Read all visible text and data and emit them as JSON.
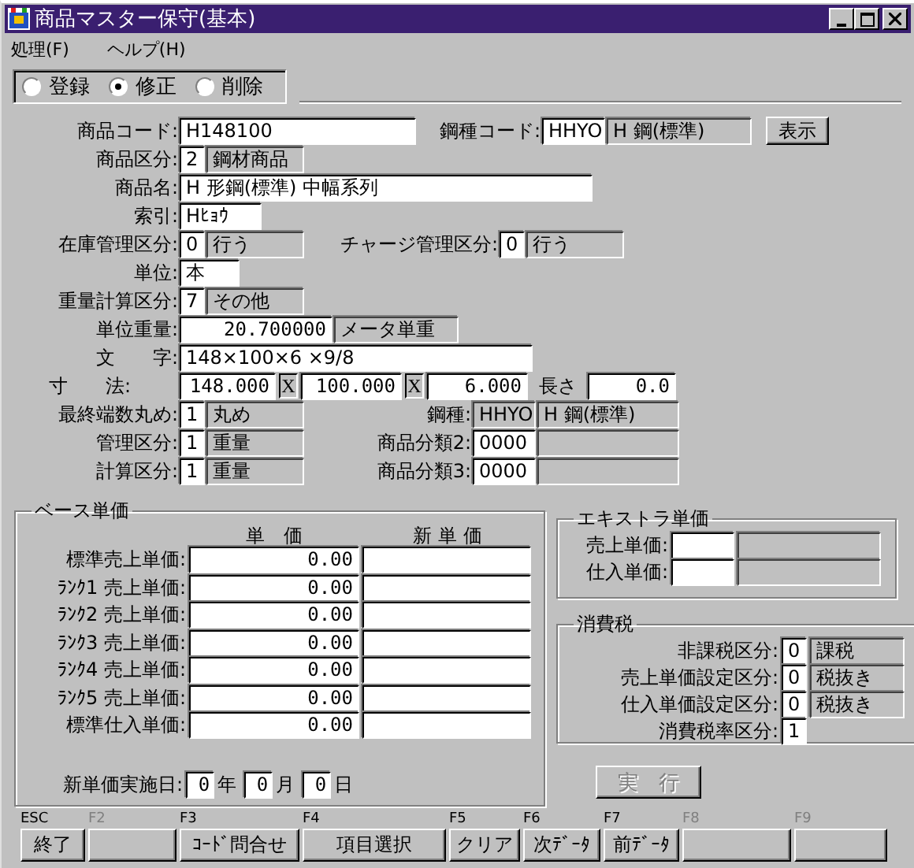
{
  "window": {
    "title": "商品マスター保守(基本)"
  },
  "menu": [
    "処理(F)",
    "ヘルプ(H)"
  ],
  "mode": [
    {
      "label": "登録",
      "selected": false
    },
    {
      "label": "修正",
      "selected": true
    },
    {
      "label": "削除",
      "selected": false
    }
  ],
  "form_rows": [
    [
      {
        "kind": "label",
        "text": "商品コード:"
      },
      {
        "kind": "input",
        "text": "H148100"
      },
      {
        "kind": "label",
        "text": "鋼種コード:"
      },
      {
        "kind": "input",
        "text": "HHYO"
      },
      {
        "kind": "display",
        "text": "H 鋼(標準)"
      },
      {
        "kind": "button",
        "text": "表示"
      }
    ],
    [
      {
        "kind": "label",
        "text": "商品区分:"
      },
      {
        "kind": "input",
        "text": "2"
      },
      {
        "kind": "display",
        "text": "鋼材商品"
      }
    ],
    [
      {
        "kind": "label",
        "text": "商品名:"
      },
      {
        "kind": "input",
        "text": "H 形鋼(標準) 中幅系列"
      }
    ],
    [
      {
        "kind": "label",
        "text": "索引:"
      },
      {
        "kind": "input",
        "text": "Hﾋｮｳ"
      }
    ],
    [
      {
        "kind": "label",
        "text": "在庫管理区分:"
      },
      {
        "kind": "input",
        "text": "0"
      },
      {
        "kind": "display",
        "text": "行う"
      },
      {
        "kind": "label",
        "text": "チャージ管理区分:"
      },
      {
        "kind": "input",
        "text": "0"
      },
      {
        "kind": "display",
        "text": "行う"
      }
    ],
    [
      {
        "kind": "label",
        "text": "単位:"
      },
      {
        "kind": "input",
        "text": "本"
      }
    ],
    [
      {
        "kind": "label",
        "text": "重量計算区分:"
      },
      {
        "kind": "input",
        "text": "7"
      },
      {
        "kind": "display",
        "text": "その他"
      }
    ],
    [
      {
        "kind": "label",
        "text": "単位重量:"
      },
      {
        "kind": "number",
        "text": "20.700000"
      },
      {
        "kind": "display",
        "text": "メータ単重"
      }
    ],
    [
      {
        "kind": "label",
        "text": "文　　字:"
      },
      {
        "kind": "input",
        "text": "148×100×6 ×9/8"
      }
    ],
    [
      {
        "kind": "label",
        "text": "寸　　法:"
      },
      {
        "kind": "number",
        "text": "148.000"
      },
      {
        "kind": "sep",
        "text": "X"
      },
      {
        "kind": "number",
        "text": "100.000"
      },
      {
        "kind": "sep",
        "text": "X"
      },
      {
        "kind": "number",
        "text": "6.000"
      },
      {
        "kind": "label",
        "text": "長さ"
      },
      {
        "kind": "number",
        "text": "0.0"
      }
    ],
    [
      {
        "kind": "label",
        "text": "最終端数丸め:"
      },
      {
        "kind": "input",
        "text": "1"
      },
      {
        "kind": "display",
        "text": "丸め"
      },
      {
        "kind": "label",
        "text": "鋼種:"
      },
      {
        "kind": "display",
        "text": "HHYO"
      },
      {
        "kind": "display",
        "text": "H 鋼(標準)"
      }
    ],
    [
      {
        "kind": "label",
        "text": "管理区分:"
      },
      {
        "kind": "input",
        "text": "1"
      },
      {
        "kind": "display",
        "text": "重量"
      },
      {
        "kind": "label",
        "text": "商品分類2:"
      },
      {
        "kind": "input",
        "text": "0000"
      },
      {
        "kind": "display"
      }
    ],
    [
      {
        "kind": "label",
        "text": "計算区分:"
      },
      {
        "kind": "input",
        "text": "1"
      },
      {
        "kind": "display",
        "text": "重量"
      },
      {
        "kind": "label",
        "text": "商品分類3:"
      },
      {
        "kind": "input",
        "text": "0000"
      },
      {
        "kind": "display"
      }
    ]
  ],
  "base_price": {
    "title": "ベース単価",
    "columns": [
      "単　価",
      "新 単 価"
    ],
    "rows": [
      {
        "label": "標準売上単価:",
        "price": "0.00"
      },
      {
        "label": "ﾗﾝｸ1 売上単価:",
        "price": "0.00"
      },
      {
        "label": "ﾗﾝｸ2 売上単価:",
        "price": "0.00"
      },
      {
        "label": "ﾗﾝｸ3 売上単価:",
        "price": "0.00"
      },
      {
        "label": "ﾗﾝｸ4 売上単価:",
        "price": "0.00"
      },
      {
        "label": "ﾗﾝｸ5 売上単価:",
        "price": "0.00"
      },
      {
        "label": "標準仕入単価:",
        "price": "0.00"
      }
    ],
    "date": {
      "label": "新単価実施日:",
      "parts": [
        {
          "value": "0",
          "unit": "年"
        },
        {
          "value": "0",
          "unit": "月"
        },
        {
          "value": "0",
          "unit": "日"
        }
      ]
    }
  },
  "extra_price": {
    "title": "エキストラ単価",
    "rows": [
      {
        "label": "売上単価:"
      },
      {
        "label": "仕入単価:"
      }
    ]
  },
  "tax": {
    "title": "消費税",
    "rows": [
      {
        "label": "非課税区分:",
        "value": "0",
        "name": "課税"
      },
      {
        "label": "売上単価設定区分:",
        "value": "0",
        "name": "税抜き"
      },
      {
        "label": "仕入単価設定区分:",
        "value": "0",
        "name": "税抜き"
      },
      {
        "label": "消費税率区分:",
        "value": "1"
      }
    ]
  },
  "execute_button": {
    "label": "実　行",
    "disabled": true
  },
  "function_keys": [
    {
      "key": "ESC",
      "label": "終了",
      "disabled": false
    },
    {
      "key": "F2",
      "disabled": true
    },
    {
      "key": "F3",
      "label": "ｺｰﾄﾞ問合せ",
      "disabled": false
    },
    {
      "key": "F4",
      "label": "項目選択",
      "disabled": false
    },
    {
      "key": "F5",
      "label": "クリア",
      "disabled": false
    },
    {
      "key": "F6",
      "label": "次ﾃﾞｰﾀ",
      "disabled": false
    },
    {
      "key": "F7",
      "label": "前ﾃﾞｰﾀ",
      "disabled": false
    },
    {
      "key": "F8",
      "disabled": true
    },
    {
      "key": "F9",
      "disabled": true
    }
  ]
}
